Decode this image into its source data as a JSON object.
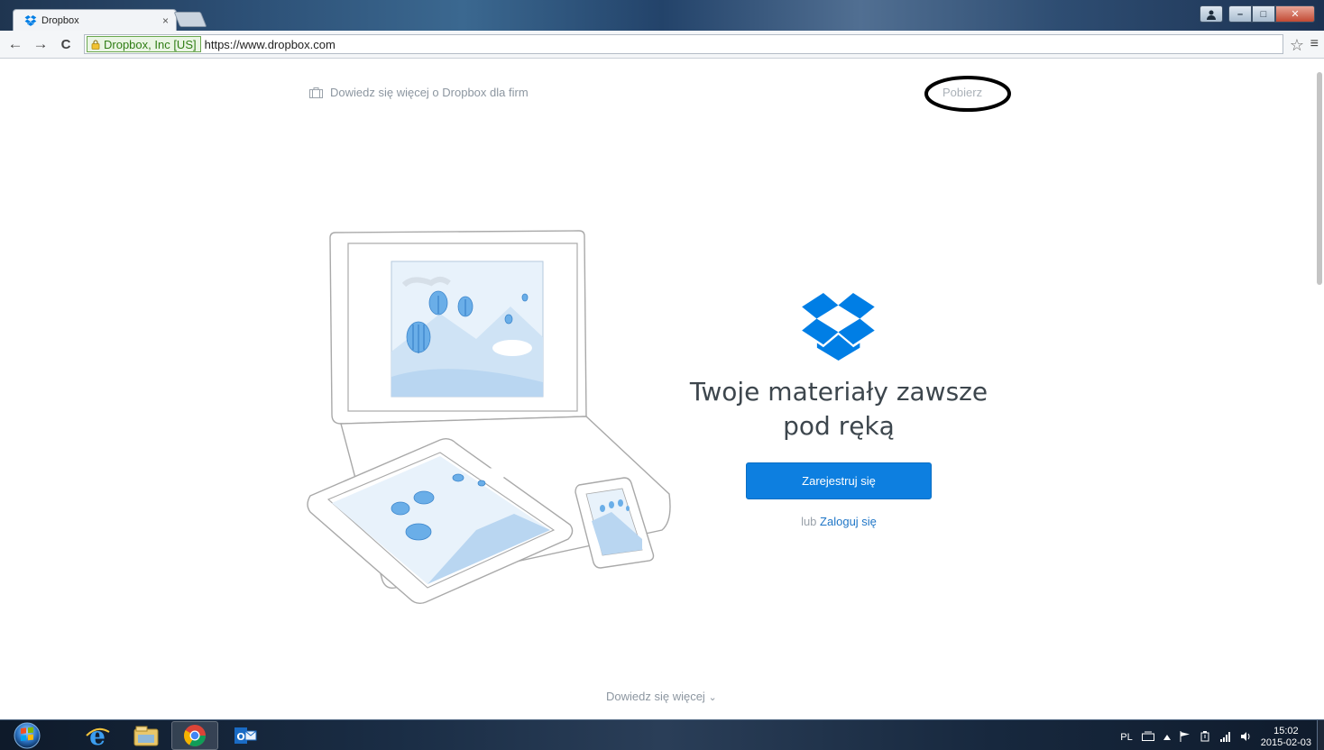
{
  "browser": {
    "tab_title": "Dropbox",
    "tab_close": "×",
    "secure_label": "Dropbox, Inc [US]",
    "url": "https://www.dropbox.com",
    "nav_back": "←",
    "nav_forward": "→",
    "nav_reload": "C",
    "star_glyph": "☆",
    "menu_glyph": "≡"
  },
  "window_controls": {
    "minimize": "–",
    "maximize": "□",
    "close": "✕"
  },
  "page": {
    "business_link": "Dowiedz się więcej o Dropbox dla firm",
    "download_link": "Pobierz",
    "headline": "Twoje materiały zawsze pod ręką",
    "signup_button": "Zarejestruj się",
    "login_prefix": "lub",
    "login_link": "Zaloguj się",
    "learn_more": "Dowiedz się więcej",
    "learn_more_chevron": "⌄"
  },
  "colors": {
    "brand_blue": "#0d7fe0",
    "logo_blue": "#007ee5",
    "link_blue": "#1f76c7",
    "annotation": "#000000"
  },
  "taskbar": {
    "items": [
      "internet-explorer-icon",
      "file-explorer-icon",
      "chrome-icon",
      "outlook-icon"
    ],
    "language": "PL",
    "time": "15:02",
    "date": "2015-02-03"
  }
}
